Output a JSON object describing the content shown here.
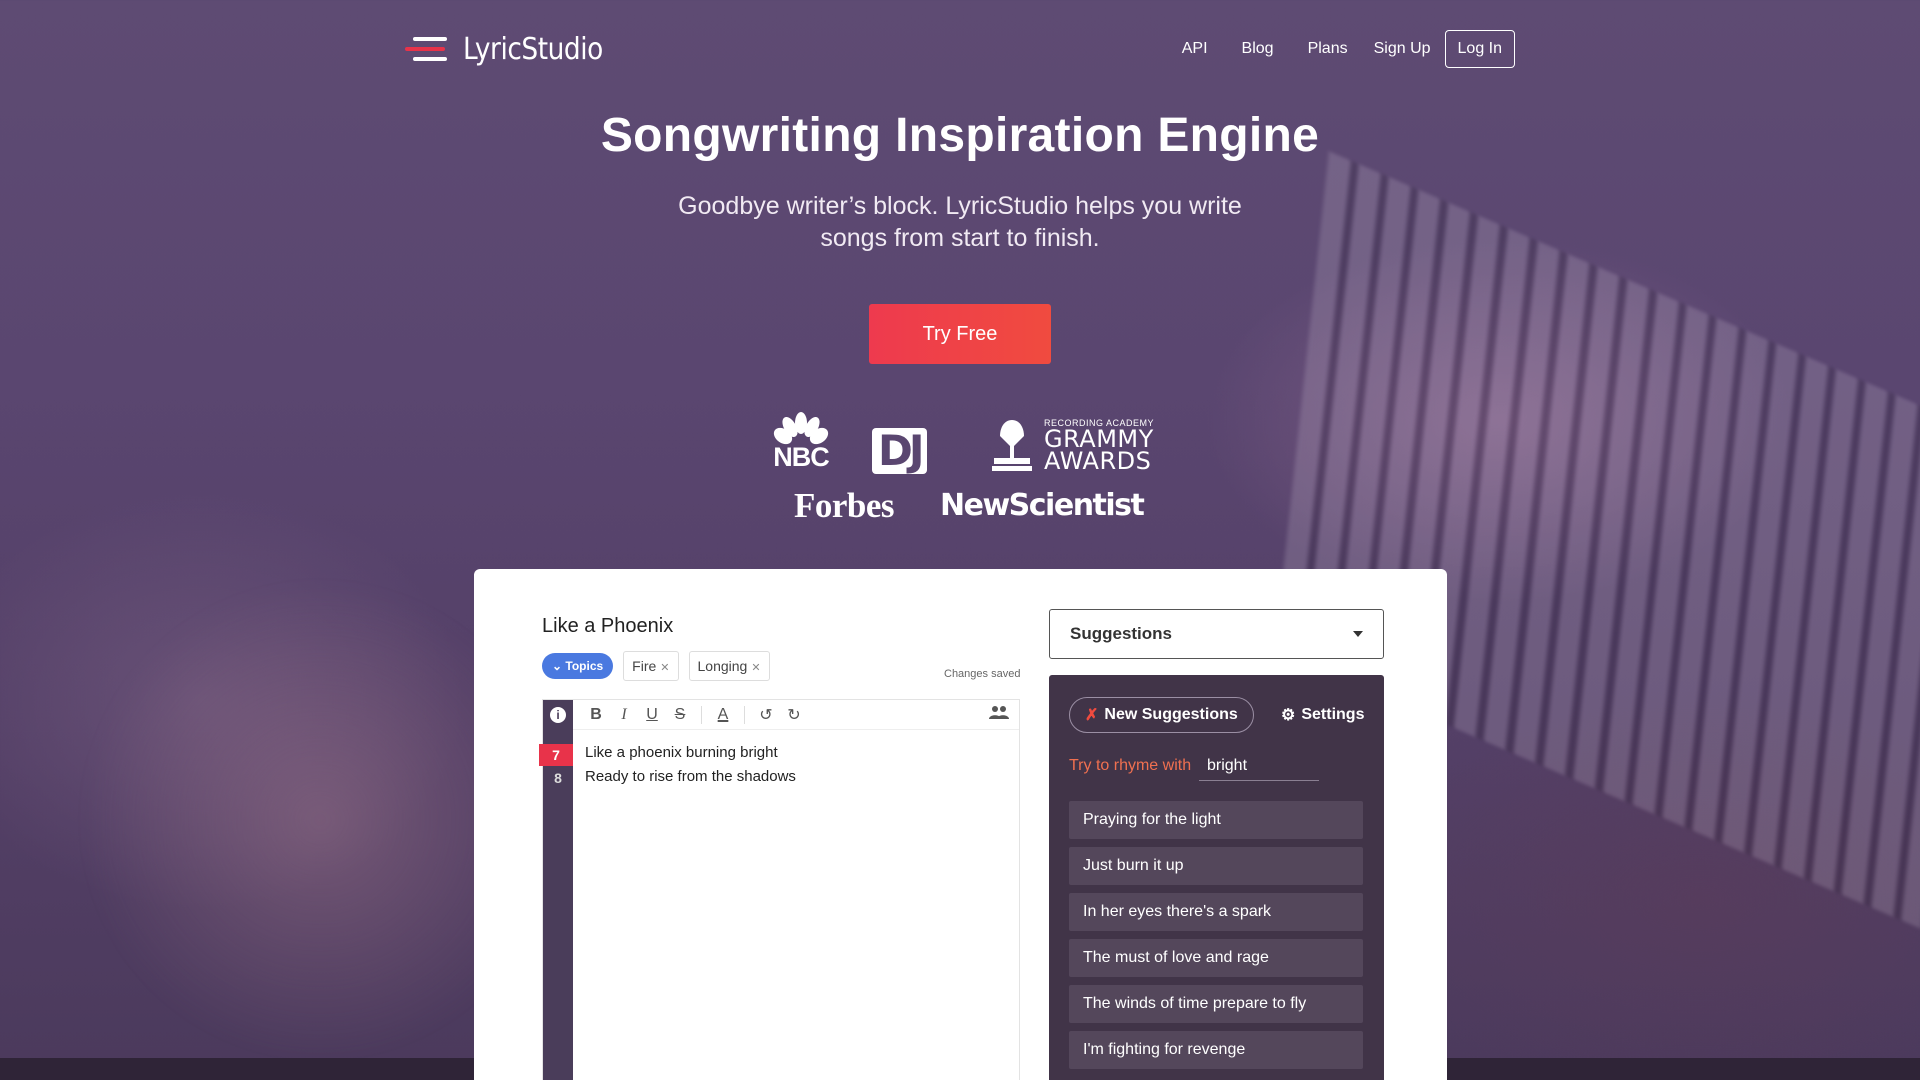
{
  "brand": {
    "name": "LyricStudio"
  },
  "nav": {
    "api": "API",
    "blog": "Blog",
    "plans": "Plans",
    "signup": "Sign Up",
    "login": "Log In"
  },
  "hero": {
    "title": "Songwriting Inspiration Engine",
    "subtitle": "Goodbye writer’s block. LyricStudio helps you write songs from start to finish.",
    "cta": "Try Free"
  },
  "press": {
    "nbc": "NBC",
    "dj": "DJ",
    "grammy_small": "RECORDING ACADEMY",
    "grammy_line1": "GRAMMY",
    "grammy_line2": "AWARDS",
    "forbes": "Forbes",
    "newscientist": "NewScientist"
  },
  "app": {
    "song_title": "Like a Phoenix",
    "topics_label": "Topics",
    "tags": [
      "Fire",
      "Longing"
    ],
    "status": "Changes saved",
    "lines": [
      {
        "number": "7",
        "text": "Like a phoenix burning bright"
      },
      {
        "number": "8",
        "text": "Ready to rise from the shadows"
      }
    ],
    "suggestions_dropdown": "Suggestions",
    "new_suggestions": "New Suggestions",
    "settings": "Settings",
    "rhyme_label": "Try to rhyme with",
    "rhyme_word": "bright",
    "suggestions": [
      "Praying for the light",
      "Just burn it up",
      "In her eyes there's a spark",
      "The must of love and rage",
      "The winds of time prepare to fly",
      "I'm fighting for revenge"
    ]
  },
  "colors": {
    "accent": "#e8334a",
    "background": "#5a4670",
    "panel": "#413448",
    "topics": "#4a79e0"
  }
}
